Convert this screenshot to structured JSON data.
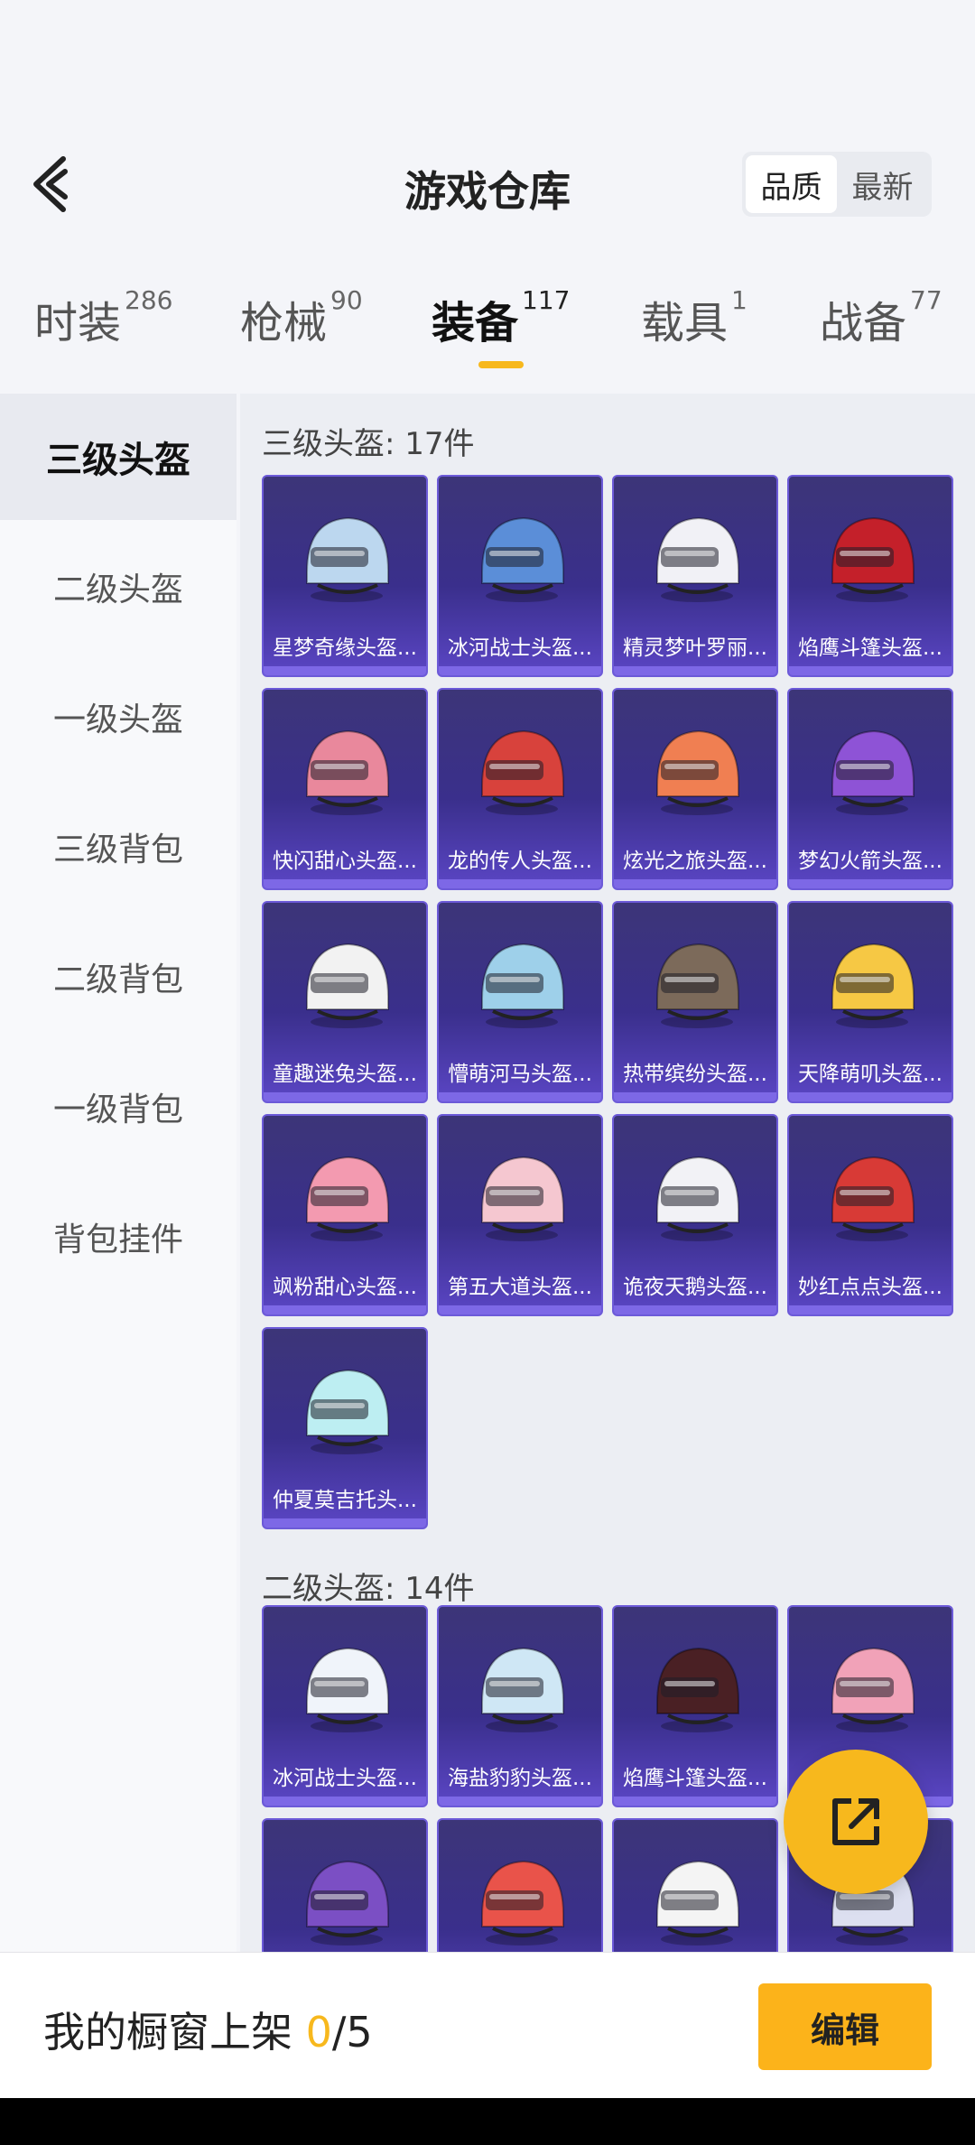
{
  "header": {
    "title": "游戏仓库",
    "sort_options": [
      "品质",
      "最新"
    ],
    "active_sort": "品质"
  },
  "tabs": [
    {
      "label": "时装",
      "count": "286"
    },
    {
      "label": "枪械",
      "count": "90"
    },
    {
      "label": "装备",
      "count": "117",
      "active": true
    },
    {
      "label": "载具",
      "count": "1"
    },
    {
      "label": "战备",
      "count": "77"
    }
  ],
  "sidebar": {
    "items": [
      {
        "label": "三级头盔",
        "active": true
      },
      {
        "label": "二级头盔"
      },
      {
        "label": "一级头盔"
      },
      {
        "label": "三级背包"
      },
      {
        "label": "二级背包"
      },
      {
        "label": "一级背包"
      },
      {
        "label": "背包挂件"
      }
    ]
  },
  "sections": [
    {
      "title": "三级头盔: 17件",
      "items": [
        {
          "label": "星梦奇缘头盔..."
        },
        {
          "label": "冰河战士头盔..."
        },
        {
          "label": "精灵梦叶罗丽..."
        },
        {
          "label": "焰鹰斗篷头盔..."
        },
        {
          "label": "快闪甜心头盔..."
        },
        {
          "label": "龙的传人头盔..."
        },
        {
          "label": "炫光之旅头盔..."
        },
        {
          "label": "梦幻火箭头盔..."
        },
        {
          "label": "童趣迷兔头盔..."
        },
        {
          "label": "懵萌河马头盔..."
        },
        {
          "label": "热带缤纷头盔..."
        },
        {
          "label": "天降萌叽头盔..."
        },
        {
          "label": "飒粉甜心头盔..."
        },
        {
          "label": "第五大道头盔..."
        },
        {
          "label": "诡夜天鹅头盔..."
        },
        {
          "label": "妙红点点头盔..."
        },
        {
          "label": "仲夏莫吉托头..."
        }
      ]
    },
    {
      "title": "二级头盔: 14件",
      "items": [
        {
          "label": "冰河战士头盔..."
        },
        {
          "label": "海盐豹豹头盔..."
        },
        {
          "label": "焰鹰斗篷头盔..."
        },
        {
          "label": ""
        },
        {
          "label": ""
        },
        {
          "label": ""
        },
        {
          "label": ""
        },
        {
          "label": ""
        }
      ]
    }
  ],
  "footer": {
    "label_prefix": "我的橱窗上架 ",
    "shelf_count": "0",
    "shelf_total": "/5",
    "edit_label": "编辑"
  },
  "colors": {
    "accent": "#f7b81d",
    "card_top": "#3c3578",
    "card_bottom": "#5b46c5"
  }
}
